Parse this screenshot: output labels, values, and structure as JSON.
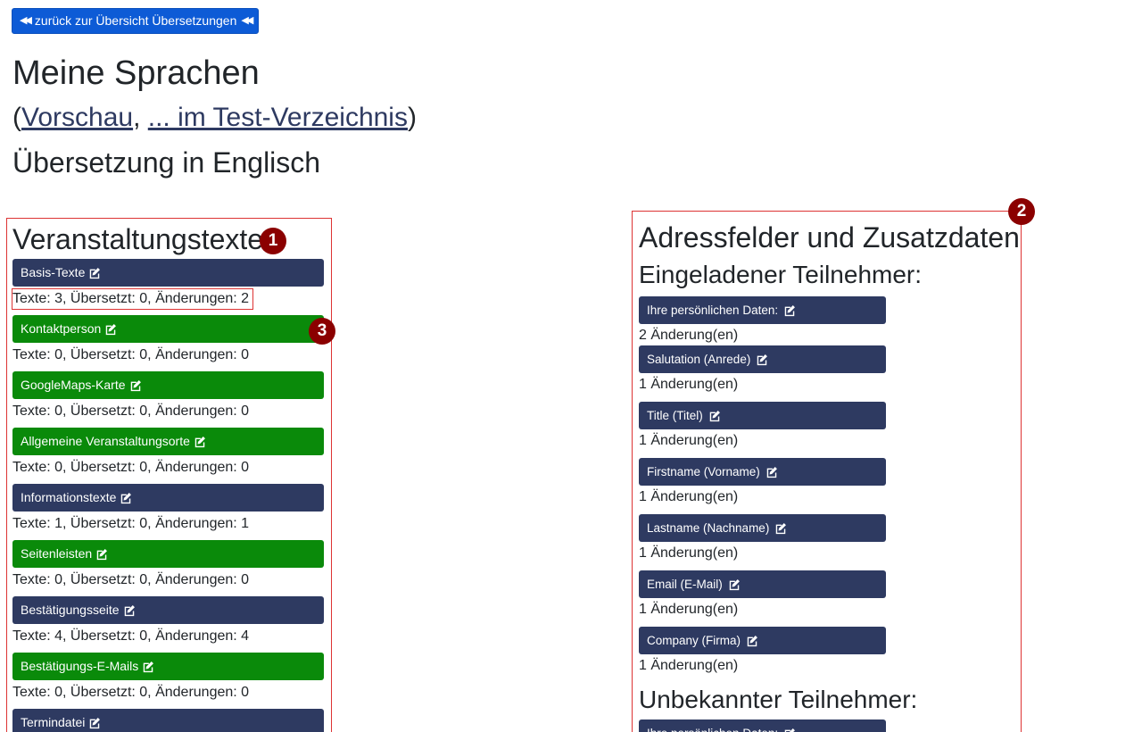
{
  "back_button": {
    "label": "zurück zur Übersicht Übersetzungen",
    "icon": "double-arrow-left-icon"
  },
  "header": {
    "title": "Meine Sprachen",
    "paren_open": "(",
    "link_preview": "Vorschau",
    "separator": ", ",
    "link_test": "... im Test-Verzeichnis",
    "paren_close": ")",
    "subtitle": "Übersetzung in Englisch"
  },
  "left": {
    "title": "Veranstaltungstexte",
    "items": [
      {
        "label": "Basis-Texte",
        "stat": "Texte: 3, Übersetzt: 0, Änderungen: 2",
        "color": "#2e3a61"
      },
      {
        "label": "Kontaktperson",
        "stat": "Texte: 0, Übersetzt: 0, Änderungen: 0",
        "color": "#0a8a0a"
      },
      {
        "label": "GoogleMaps-Karte",
        "stat": "Texte: 0, Übersetzt: 0, Änderungen: 0",
        "color": "#0a8a0a"
      },
      {
        "label": "Allgemeine Veranstaltungsorte",
        "stat": "Texte: 0, Übersetzt: 0, Änderungen: 0",
        "color": "#0a8a0a"
      },
      {
        "label": "Informationstexte",
        "stat": "Texte: 1, Übersetzt: 0, Änderungen: 1",
        "color": "#2e3a61"
      },
      {
        "label": "Seitenleisten",
        "stat": "Texte: 0, Übersetzt: 0, Änderungen: 0",
        "color": "#0a8a0a"
      },
      {
        "label": "Bestätigungsseite",
        "stat": "Texte: 4, Übersetzt: 0, Änderungen: 4",
        "color": "#2e3a61"
      },
      {
        "label": "Bestätigungs-E-Mails",
        "stat": "Texte: 0, Übersetzt: 0, Änderungen: 0",
        "color": "#0a8a0a"
      },
      {
        "label": "Termindatei",
        "stat": "",
        "color": "#2e3a61"
      }
    ]
  },
  "right": {
    "title": "Adressfelder und Zusatzdaten",
    "invited_title": "Eingeladener Teilnehmer:",
    "items": [
      {
        "label": "Ihre persönlichen Daten:",
        "stat": "2 Änderung(en)"
      },
      {
        "label": "Salutation (Anrede)",
        "stat": "1 Änderung(en)"
      },
      {
        "label": "Title (Titel)",
        "stat": "1 Änderung(en)"
      },
      {
        "label": "Firstname (Vorname)",
        "stat": "1 Änderung(en)"
      },
      {
        "label": "Lastname (Nachname)",
        "stat": "1 Änderung(en)"
      },
      {
        "label": "Email (E-Mail)",
        "stat": "1 Änderung(en)"
      },
      {
        "label": "Company (Firma)",
        "stat": "1 Änderung(en)"
      }
    ],
    "unknown_title": "Unbekannter Teilnehmer:",
    "unknown_first_item": "Ihre persönlichen Daten:"
  },
  "badges": [
    "1",
    "2",
    "3"
  ],
  "colors": {
    "navy": "#2e3a61",
    "green": "#0a8a0a",
    "blue": "#0d5bd6",
    "badge": "#8b0000",
    "highlight": "#dd3333"
  }
}
